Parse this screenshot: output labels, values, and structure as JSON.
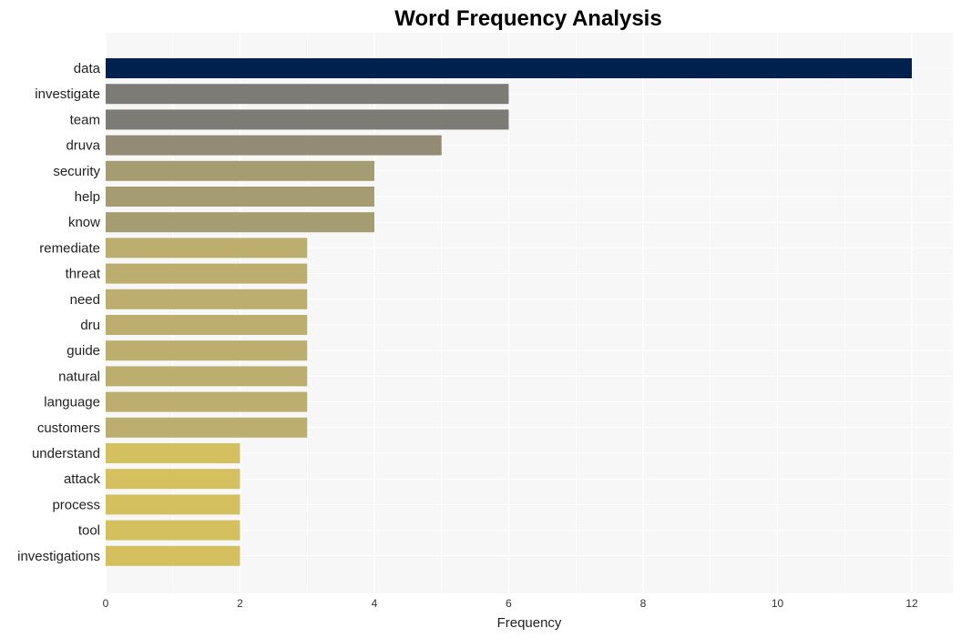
{
  "chart_data": {
    "type": "bar",
    "orientation": "horizontal",
    "title": "Word Frequency Analysis",
    "xlabel": "Frequency",
    "ylabel": "",
    "xlim": [
      0,
      12.6
    ],
    "xticks": [
      0,
      2,
      4,
      6,
      8,
      10,
      12
    ],
    "grid": true,
    "legend": null,
    "categories": [
      "data",
      "investigate",
      "team",
      "druva",
      "security",
      "help",
      "know",
      "remediate",
      "threat",
      "need",
      "dru",
      "guide",
      "natural",
      "language",
      "customers",
      "understand",
      "attack",
      "process",
      "tool",
      "investigations"
    ],
    "values": [
      12,
      6,
      6,
      5,
      4,
      4,
      4,
      3,
      3,
      3,
      3,
      3,
      3,
      3,
      3,
      2,
      2,
      2,
      2,
      2
    ],
    "colors": {
      "12": "#00214d",
      "6": "#7d7b76",
      "5": "#938b76",
      "4": "#a59c72",
      "3": "#bcae6e",
      "2": "#d4c05e"
    },
    "background": "#f7f7f7",
    "grid_color": "#ffffff"
  }
}
